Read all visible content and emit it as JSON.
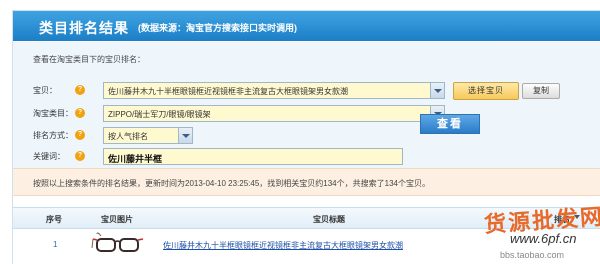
{
  "header": {
    "title": "类目排名结果",
    "subtitle": "(数据来源：淘宝官方搜索接口实时调用)"
  },
  "form": {
    "heading": "查看在淘宝类目下的宝贝排名：",
    "item": {
      "label": "宝贝：",
      "value": "佐川藤井木九十半框眼镜框近视镜框非主流复古大框眼镜架男女款潮",
      "select_button": "选择宝贝",
      "copy_button": "复制"
    },
    "category": {
      "label": "淘宝类目：",
      "value": "ZIPPO/瑞士军刀/眼镜/眼镜架"
    },
    "sort": {
      "label": "排名方式：",
      "value": "按人气排名"
    },
    "keyword": {
      "label": "关键词：",
      "value": "佐川藤井半框"
    },
    "search_button": "查看",
    "help_icon": "question-icon"
  },
  "result": {
    "text": "按照以上搜索条件的排名结果，更新时间为2013-04-10 23:25:45，找到相关宝贝约134个，共搜索了134个宝贝。"
  },
  "table": {
    "columns": [
      "序号",
      "宝贝图片",
      "宝贝标题",
      "排名"
    ],
    "rows": [
      {
        "index": "1",
        "image": "glasses-thumbnail",
        "title": "佐川藤井木九十半框眼镜框近视镜框非主流复古大框眼镜架男女款潮"
      }
    ]
  },
  "watermark": {
    "text": "货源批发网",
    "url": "www.6pf.cn",
    "url2": "bbs.taobao.com"
  },
  "colors": {
    "title_bar": "#1c7fc7",
    "help_icon": "#f2a20c",
    "select_button": "#f7c95a",
    "search_button": "#2a7bc9",
    "result_bar": "#fdf0e2"
  }
}
